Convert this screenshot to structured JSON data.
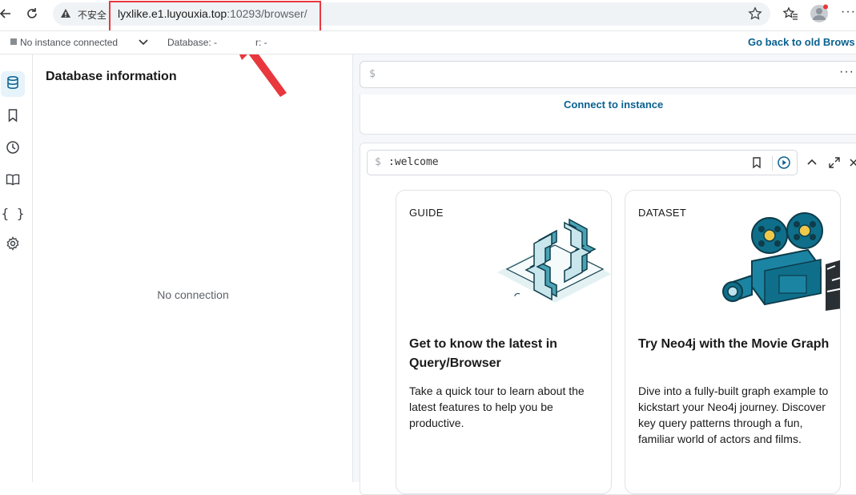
{
  "browser": {
    "insecure_label": "不安全",
    "url_host": "lyxlike.e1.luyouxia.top",
    "url_rest": ":10293/browser/",
    "accent": "#e8383d"
  },
  "topbar": {
    "instance_status": "No instance connected",
    "database_label": "Database: -",
    "user_label": "r: -",
    "old_browser_link": "Go back to old Brows"
  },
  "rail": {
    "items": [
      {
        "icon": "database-icon",
        "active": true
      },
      {
        "icon": "bookmark-icon",
        "active": false
      },
      {
        "icon": "history-icon",
        "active": false
      },
      {
        "icon": "book-icon",
        "active": false
      },
      {
        "icon": "braces-icon",
        "active": false
      },
      {
        "icon": "gear-icon",
        "active": false
      }
    ]
  },
  "db_panel": {
    "title": "Database information",
    "empty_state": "No connection"
  },
  "editor": {
    "prompt": "$",
    "more": "···"
  },
  "connect": {
    "link": "Connect to instance"
  },
  "frame": {
    "prompt": "$",
    "command": ":welcome"
  },
  "cards": [
    {
      "kicker": "GUIDE",
      "title": "Get to know the latest in Query/Browser",
      "body": "Take a quick tour to learn about the latest features to help you be productive."
    },
    {
      "kicker": "DATASET",
      "title": "Try Neo4j with the Movie Graph",
      "body": "Dive into a fully-built graph example to kickstart your Neo4j journey. Discover key query patterns through a fun, familiar world of actors and films."
    }
  ],
  "colors": {
    "link": "#0a6190",
    "teal": "#0f6f8a"
  }
}
